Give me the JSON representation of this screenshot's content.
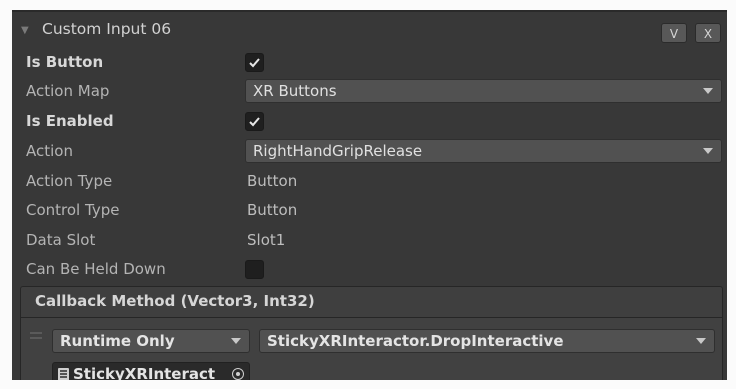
{
  "header": {
    "title": "Custom Input 06",
    "btn_v": "V",
    "btn_x": "X"
  },
  "fields": {
    "is_button": {
      "label": "Is Button",
      "checked": true
    },
    "action_map": {
      "label": "Action Map",
      "value": "XR Buttons"
    },
    "is_enabled": {
      "label": "Is Enabled",
      "checked": true
    },
    "action": {
      "label": "Action",
      "value": "RightHandGripRelease"
    },
    "action_type": {
      "label": "Action Type",
      "value": "Button"
    },
    "control_type": {
      "label": "Control Type",
      "value": "Button"
    },
    "data_slot": {
      "label": "Data Slot",
      "value": "Slot1"
    },
    "can_be_held_down": {
      "label": "Can Be Held Down",
      "checked": false
    }
  },
  "callback": {
    "title": "Callback Method (Vector3, Int32)",
    "runtime": "Runtime Only",
    "method": "StickyXRInteractor.DropInteractive",
    "object": "StickyXRInteract"
  }
}
